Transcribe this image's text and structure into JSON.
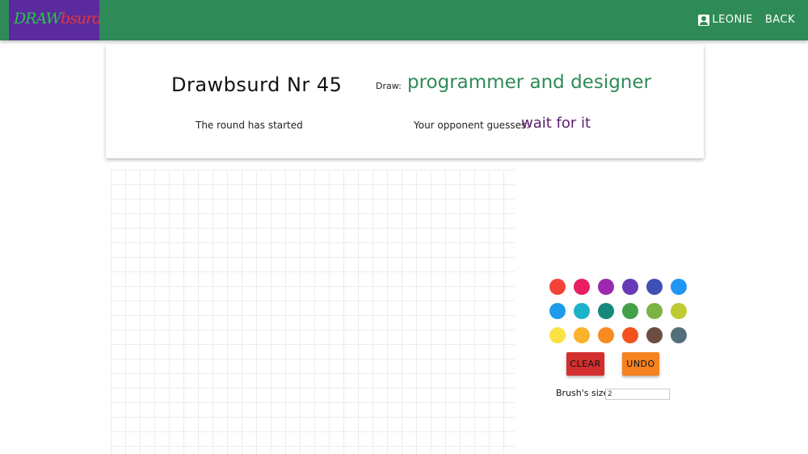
{
  "app": {
    "logo_text_a": "DRAW",
    "logo_text_b": "bsurd"
  },
  "nav": {
    "user_label": "LEONIE",
    "back_label": "BACK"
  },
  "game": {
    "title": "Drawbsurd Nr 45",
    "round_status": "The round has started",
    "draw_label": "Draw:",
    "draw_word": "programmer and designer",
    "guess_label": "Your opponent guesses:",
    "guess_word": "wait for it"
  },
  "palette": {
    "colors": [
      "#f44336",
      "#e91e63",
      "#9c27b0",
      "#673ab7",
      "#3f51b5",
      "#2196f3",
      "#1e9be9",
      "#1cb3c9",
      "#15897b",
      "#43a047",
      "#7cb342",
      "#c0ca33",
      "#fbe144",
      "#fbb22b",
      "#f88b23",
      "#f4511e",
      "#6d4c41",
      "#546e7a"
    ]
  },
  "controls": {
    "clear_label": "CLEAR",
    "undo_label": "UNDO",
    "brush_label": "Brush's size",
    "brush_value": "2"
  },
  "theme": {
    "primary": "#2e8b57",
    "logo_bg": "#5b2a9e",
    "guess_color": "#5b1f6b"
  }
}
